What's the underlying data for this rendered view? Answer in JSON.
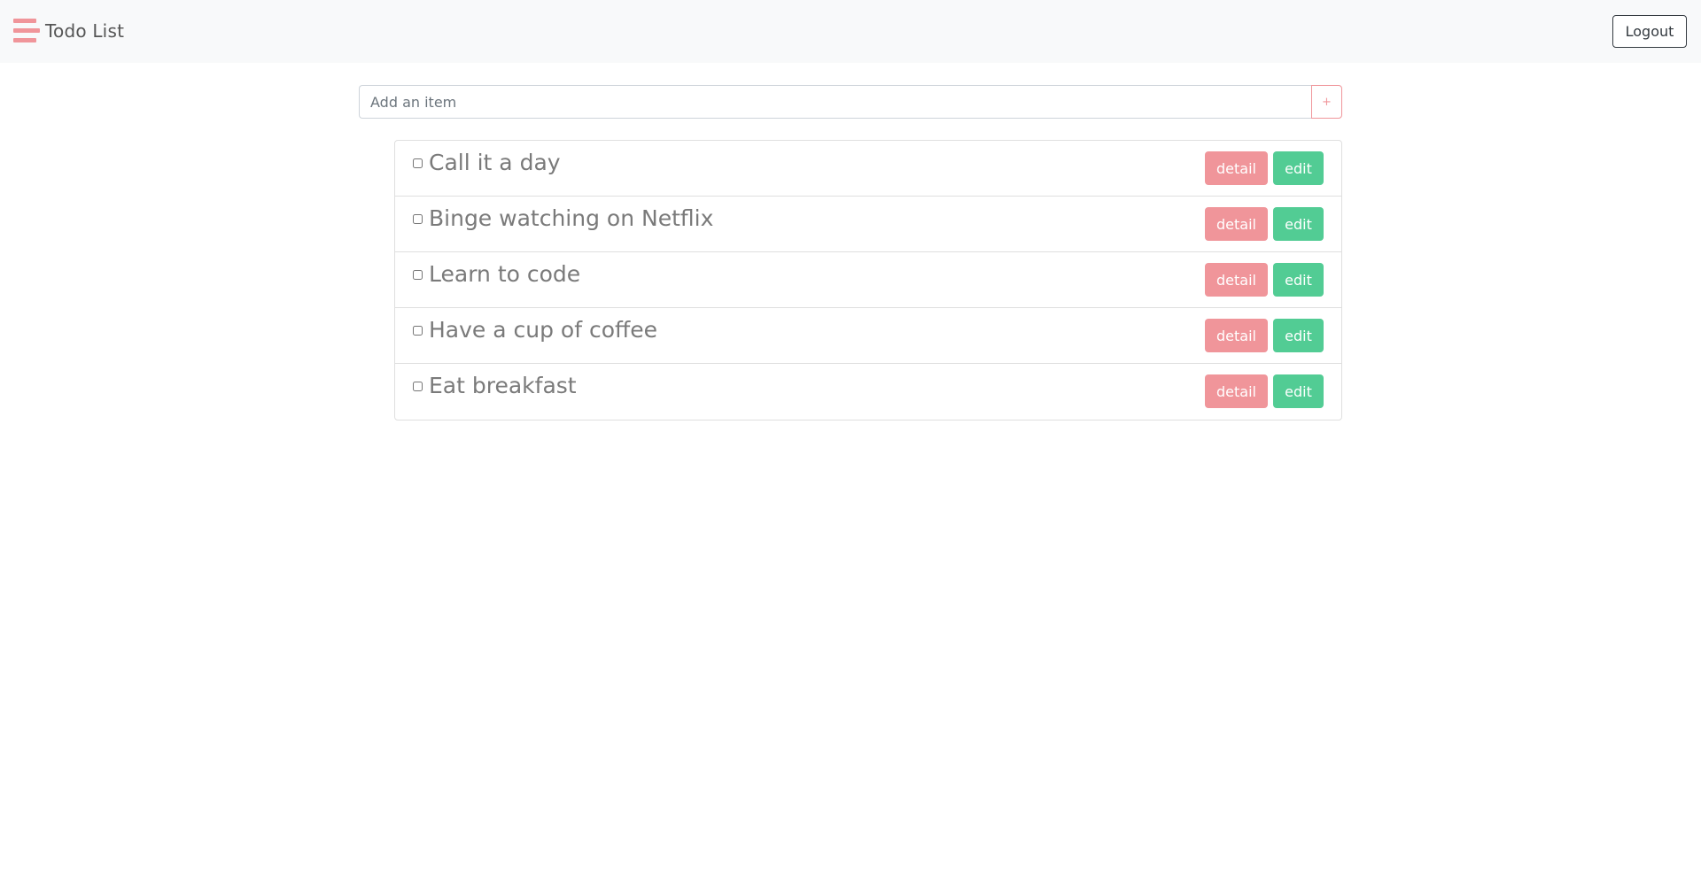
{
  "navbar": {
    "brand_icon": "menu-bars-icon",
    "title": "Todo List",
    "logout_label": "Logout"
  },
  "add_item": {
    "placeholder": "Add an item",
    "value": "",
    "add_button_label": "+"
  },
  "todos": [
    {
      "text": "Call it a day",
      "checked": false,
      "detail_label": "detail",
      "edit_label": "edit"
    },
    {
      "text": "Binge watching on Netflix",
      "checked": false,
      "detail_label": "detail",
      "edit_label": "edit"
    },
    {
      "text": "Learn to code",
      "checked": false,
      "detail_label": "detail",
      "edit_label": "edit"
    },
    {
      "text": "Have a cup of coffee",
      "checked": false,
      "detail_label": "detail",
      "edit_label": "edit"
    },
    {
      "text": "Eat breakfast",
      "checked": false,
      "detail_label": "detail",
      "edit_label": "edit"
    }
  ],
  "colors": {
    "brand_accent": "#f0959a",
    "detail_button": "#f0959a",
    "edit_button": "#52cc94",
    "navbar_bg": "#f8f9fa"
  }
}
